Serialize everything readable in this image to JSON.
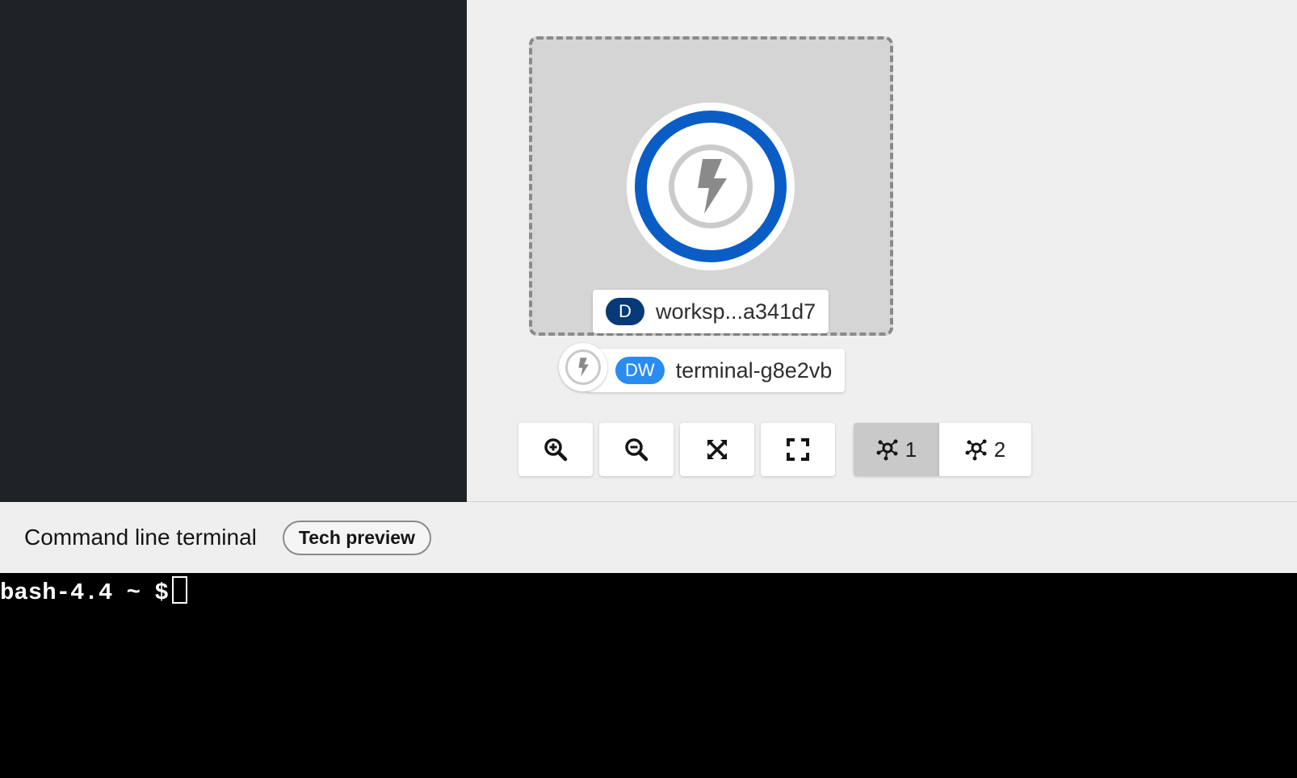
{
  "topology": {
    "group_label": {
      "badge": "D",
      "name": "worksp...a341d7"
    },
    "node_label": {
      "badge": "DW",
      "name": "terminal-g8e2vb"
    },
    "node_icon": "bolt-icon",
    "controls": {
      "zoom_in": "zoom-in-icon",
      "zoom_out": "zoom-out-icon",
      "fit": "fit-to-screen-icon",
      "reset": "expand-icon",
      "layout1_label": "1",
      "layout2_label": "2"
    }
  },
  "terminal": {
    "title": "Command line terminal",
    "badge": "Tech preview",
    "prompt": "bash-4.4 ~ $"
  },
  "colors": {
    "sidebar": "#1f2326",
    "node_ring": "#0b5dc6",
    "badge_d": "#063a79",
    "badge_dw": "#2b8cef"
  }
}
